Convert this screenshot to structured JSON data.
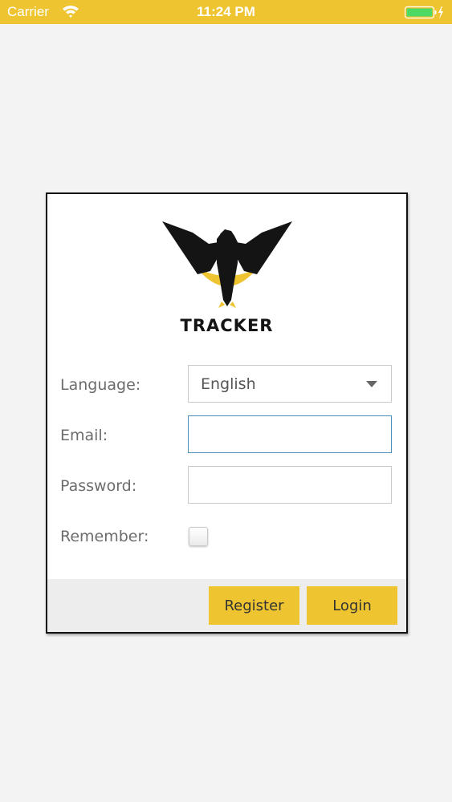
{
  "status_bar": {
    "carrier": "Carrier",
    "time": "11:24 PM",
    "accent_color": "#eec531",
    "battery_color": "#4cd964",
    "icons": [
      "wifi-icon",
      "battery-icon",
      "charging-bolt-icon"
    ]
  },
  "login": {
    "brand": "TRACKER",
    "logo_icon": "eagle-logo-icon",
    "language_label": "Language:",
    "language_value": "English",
    "email_label": "Email:",
    "email_value": "",
    "password_label": "Password:",
    "password_value": "",
    "remember_label": "Remember:",
    "remember_checked": false,
    "register_label": "Register",
    "login_label": "Login",
    "button_color": "#eec531",
    "focus_border_color": "#4a8fb8"
  }
}
